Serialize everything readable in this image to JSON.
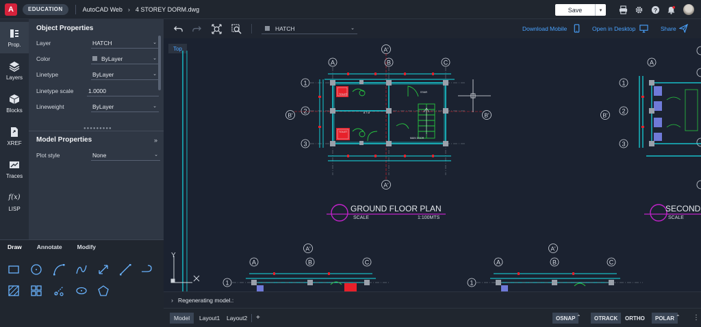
{
  "topbar": {
    "logo_letter": "A",
    "edu_badge": "EDUCATION",
    "app_name": "AutoCAD Web",
    "file_name": "4 STOREY DORM.dwg",
    "save_label": "Save"
  },
  "rail": {
    "items": [
      {
        "label": "Prop.",
        "icon": "properties-icon"
      },
      {
        "label": "Layers",
        "icon": "layers-icon"
      },
      {
        "label": "Blocks",
        "icon": "blocks-icon"
      },
      {
        "label": "XREF",
        "icon": "xref-icon"
      },
      {
        "label": "Traces",
        "icon": "traces-icon"
      },
      {
        "label": "LISP",
        "icon": "lisp-icon"
      }
    ],
    "lisp_glyph": "f(x)"
  },
  "object_properties": {
    "title": "Object Properties",
    "rows": [
      {
        "label": "Layer",
        "value": "HATCH"
      },
      {
        "label": "Color",
        "value": "ByLayer"
      },
      {
        "label": "Linetype",
        "value": "ByLayer"
      },
      {
        "label": "Linetype scale",
        "value": "1.0000"
      },
      {
        "label": "Lineweight",
        "value": "ByLayer"
      }
    ]
  },
  "model_properties": {
    "title": "Model Properties",
    "rows": [
      {
        "label": "Plot style",
        "value": "None"
      }
    ]
  },
  "tools": {
    "tabs": [
      "Draw",
      "Annotate",
      "Modify"
    ],
    "active_tab": "Draw"
  },
  "view_toolbar": {
    "layer_value": "HATCH",
    "download_mobile": "Download Mobile",
    "open_desktop": "Open in Desktop",
    "share": "Share",
    "view_tab": "Top"
  },
  "drawing": {
    "plan1_title": "GROUND FLOOR PLAN",
    "plan1_scale_label": "SCALE",
    "plan1_scale_value": "1:100MTS",
    "plan2_title": "SECOND",
    "plan2_scale_label": "SCALE",
    "grid_cols": [
      "A",
      "B",
      "C"
    ],
    "grid_rows": [
      "1",
      "2",
      "3"
    ],
    "section_a": "A'",
    "section_b": "B'",
    "room_labels": [
      "STAIR",
      "TOILET",
      "TOILET",
      "B T M",
      "MAIN DOOR"
    ],
    "ucs_y": "Y",
    "ucs_x": "X"
  },
  "cmdline": {
    "text": "Regenerating model.:"
  },
  "statusbar": {
    "layouts": [
      "Model",
      "Layout1",
      "Layout2"
    ],
    "active_layout": "Model",
    "snaps": [
      {
        "label": "OSNAP",
        "on": true
      },
      {
        "label": "OTRACK",
        "on": true
      },
      {
        "label": "ORTHO",
        "on": false
      },
      {
        "label": "POLAR",
        "on": true
      }
    ]
  },
  "colors": {
    "accent": "#4aa3ff",
    "wall": "#17e0e8",
    "hatch_red": "#e8202a",
    "green": "#27c940",
    "magenta": "#c022c8",
    "background": "#1b2230"
  }
}
